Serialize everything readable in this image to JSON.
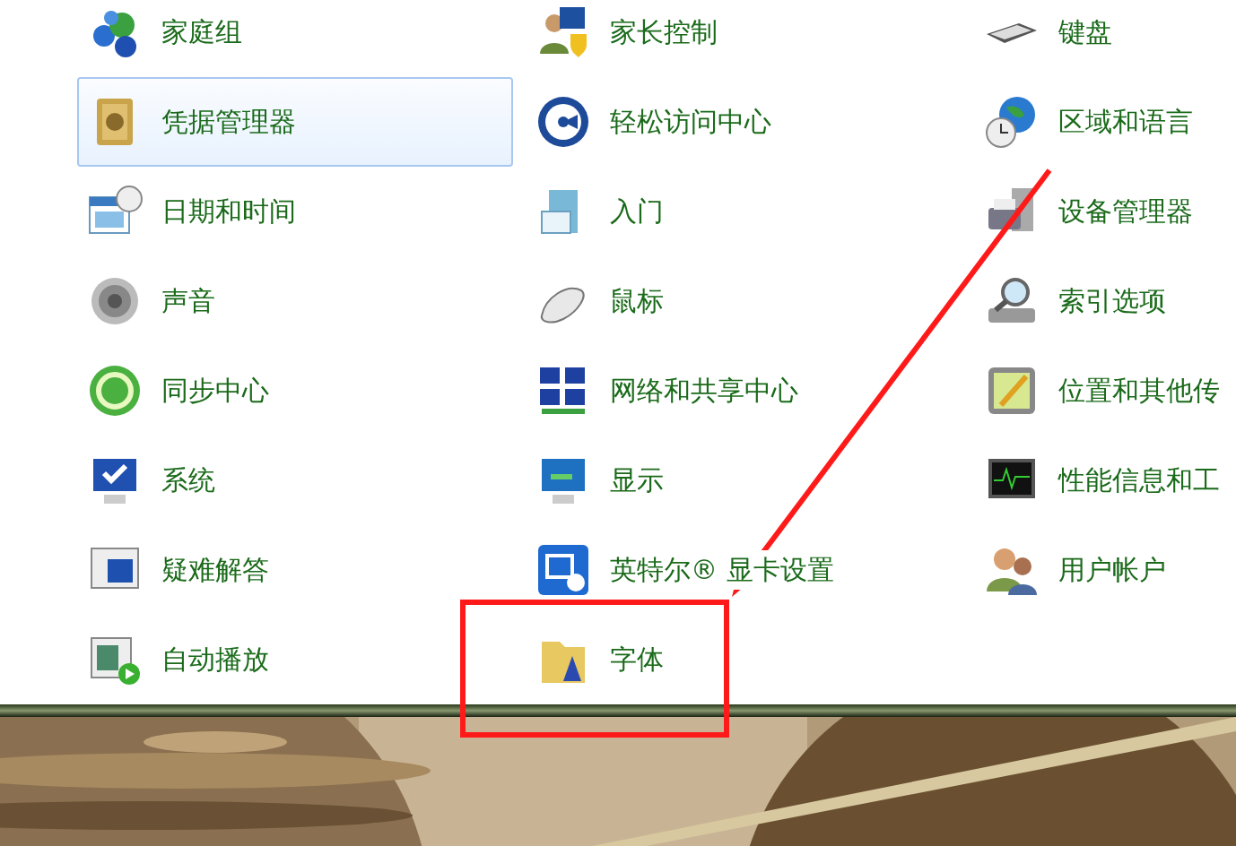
{
  "items": [
    {
      "label": "家庭组",
      "highlighted": false,
      "annotated": false
    },
    {
      "label": "家长控制",
      "highlighted": false,
      "annotated": false
    },
    {
      "label": "键盘",
      "highlighted": false,
      "annotated": false
    },
    {
      "label": "凭据管理器",
      "highlighted": true,
      "annotated": false
    },
    {
      "label": "轻松访问中心",
      "highlighted": false,
      "annotated": false
    },
    {
      "label": "区域和语言",
      "highlighted": false,
      "annotated": false
    },
    {
      "label": "日期和时间",
      "highlighted": false,
      "annotated": false
    },
    {
      "label": "入门",
      "highlighted": false,
      "annotated": false
    },
    {
      "label": "设备管理器",
      "highlighted": false,
      "annotated": false
    },
    {
      "label": "声音",
      "highlighted": false,
      "annotated": false
    },
    {
      "label": "鼠标",
      "highlighted": false,
      "annotated": false
    },
    {
      "label": "索引选项",
      "highlighted": false,
      "annotated": false
    },
    {
      "label": "同步中心",
      "highlighted": false,
      "annotated": false
    },
    {
      "label": "网络和共享中心",
      "highlighted": false,
      "annotated": false
    },
    {
      "label": "位置和其他传",
      "highlighted": false,
      "annotated": false
    },
    {
      "label": "系统",
      "highlighted": false,
      "annotated": false
    },
    {
      "label": "显示",
      "highlighted": false,
      "annotated": false
    },
    {
      "label": "性能信息和工",
      "highlighted": false,
      "annotated": false
    },
    {
      "label": "疑难解答",
      "highlighted": false,
      "annotated": false
    },
    {
      "label": "英特尔® 显卡设置",
      "highlighted": false,
      "annotated": false
    },
    {
      "label": "用户帐户",
      "highlighted": false,
      "annotated": false
    },
    {
      "label": "自动播放",
      "highlighted": false,
      "annotated": false
    },
    {
      "label": "字体",
      "highlighted": false,
      "annotated": true
    }
  ]
}
